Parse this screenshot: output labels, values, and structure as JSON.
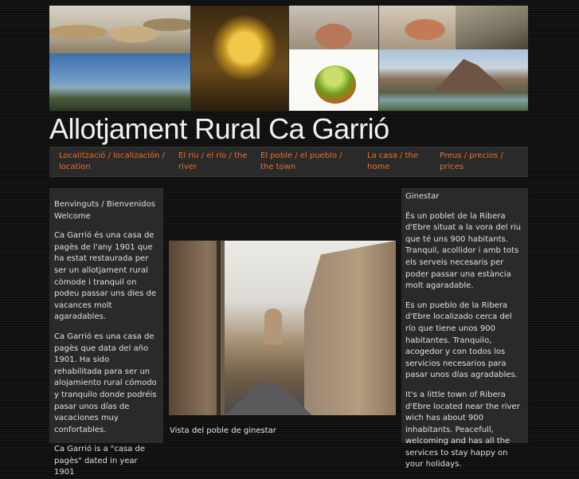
{
  "site": {
    "title": "Allotjament Rural Ca Garrió"
  },
  "nav": {
    "items": [
      {
        "label": "Localització / localización / location"
      },
      {
        "label": "El riu / el río / the river"
      },
      {
        "label": "El poble / el pueblo / the town"
      },
      {
        "label": "La casa / the home"
      },
      {
        "label": "Preus / precios / prices"
      }
    ]
  },
  "left": {
    "paragraphs": [
      "Benvinguts / Bienvenidos Welcome",
      "Ca Garrió és una casa de pagès de l'any 1901 que ha estat restaurada per ser un allotjament rural còmode i tranquil on podeu passar uns dies de vacances molt agaradables.",
      "Ca Garrió es una casa de pagès que data del año 1901. Ha sido rehabilitada para ser un alojamiento rural cómodo y tranquilo donde podréis pasar unos días de vacaciones muy confortables.",
      "Ca Garrió is a \"casa de pagès\" dated in year 1901"
    ]
  },
  "right": {
    "paragraphs": [
      "Ginestar",
      "És un poblet de la Ribera d'Ebre situat a la vora del riu que té uns 900 habitants. Tranquil, acollidor i amb tots els serveis necesaris per poder passar una estància molt agaradable.",
      "Es un pueblo de la Ribera d'Ebre localizado cerca del río que tiene unos 900 habitantes. Tranquilo, acogedor y con todos los servicios necesarios para pasar unos días agradables.",
      "It's a little town of Ribera d'Ebre located near the river wich has about 900 inhabitants. Peacefull, welcoming and has all the services to stay happy on your holidays."
    ]
  },
  "main": {
    "caption": "Vista del poble de ginestar"
  }
}
